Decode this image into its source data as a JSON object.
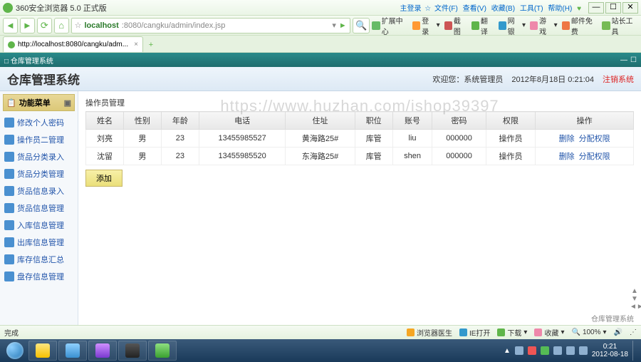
{
  "browser": {
    "title": "360安全浏览器 5.0  正式版",
    "menu_items": [
      "主登录",
      "文件(F)",
      "查看(V)",
      "收藏(B)",
      "工具(T)",
      "帮助(H)"
    ],
    "url_prefix": "localhost",
    "url_rest": ":8080/cangku/admin/index.jsp",
    "tab_label": "http://localhost:8080/cangku/adm...",
    "tools": [
      "扩展中心",
      "登录",
      "截图",
      "翻译",
      "网银",
      "游戏",
      "邮件免费",
      "站长工具"
    ]
  },
  "app": {
    "window_title": "仓库管理系统",
    "system_title": "仓库管理系统",
    "welcome_label": "欢迎您：",
    "welcome_user": "系统管理员",
    "datetime": "2012年8月18日  0:21:04",
    "logout": "注销系统",
    "menu_header": "功能菜单",
    "menu_sub": "",
    "menu": [
      "修改个人密码",
      "操作员二管理",
      "货品分类录入",
      "货品分类管理",
      "货品信息录入",
      "货品信息管理",
      "入库信息管理",
      "出库信息管理",
      "库存信息汇总",
      "盘存信息管理"
    ],
    "panel_title": "操作员管理",
    "columns": [
      "姓名",
      "性别",
      "年龄",
      "电话",
      "住址",
      "职位",
      "账号",
      "密码",
      "权限",
      "操作"
    ],
    "rows": [
      {
        "name": "刘亮",
        "sex": "男",
        "age": "23",
        "phone": "13455985527",
        "addr": "黄海路25#",
        "job": "库管",
        "acct": "liu",
        "pwd": "000000",
        "priv": "操作员",
        "act1": "删除",
        "act2": "分配权限"
      },
      {
        "name": "沈留",
        "sex": "男",
        "age": "23",
        "phone": "13455985520",
        "addr": "东海路25#",
        "job": "库管",
        "acct": "shen",
        "pwd": "000000",
        "priv": "操作员",
        "act1": "删除",
        "act2": "分配权限"
      }
    ],
    "add_btn": "添加",
    "footer": "仓库管理系统"
  },
  "watermark": "https://www.huzhan.com/ishop39397",
  "status": {
    "left": "完成",
    "items": [
      "浏览器医生",
      "IE打开",
      "下载",
      "收藏",
      "100%"
    ]
  },
  "tray": {
    "time": "0:21",
    "date": "2012-08-18"
  }
}
